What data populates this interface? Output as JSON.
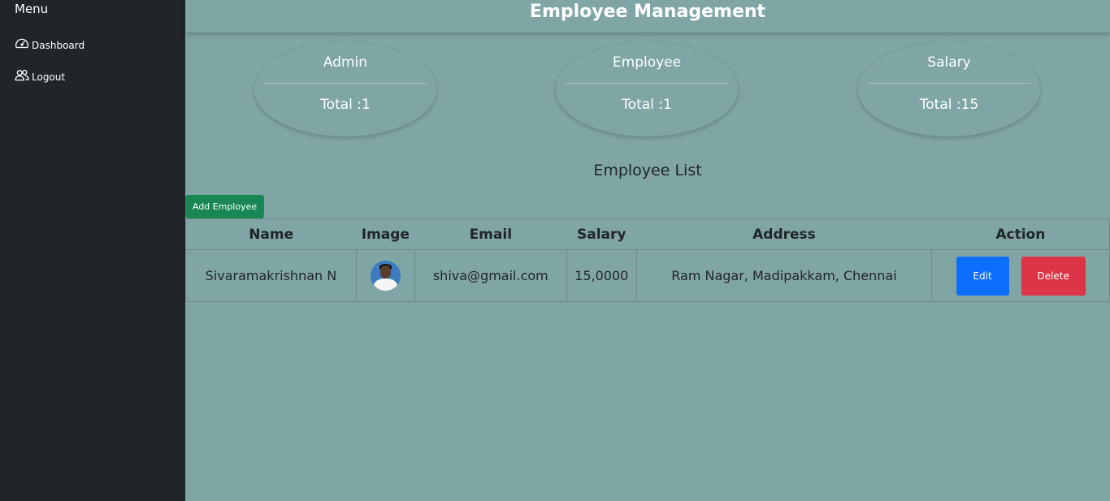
{
  "sidebar": {
    "title": "Menu",
    "items": [
      {
        "label": "Dashboard",
        "icon": "speedometer-icon"
      },
      {
        "label": "Logout",
        "icon": "people-icon"
      }
    ]
  },
  "header": {
    "title": "Employee Management"
  },
  "stats": [
    {
      "label": "Admin",
      "value": "Total :1"
    },
    {
      "label": "Employee",
      "value": "Total :1"
    },
    {
      "label": "Salary",
      "value": "Total :15"
    }
  ],
  "list": {
    "title": "Employee List",
    "add_button": "Add Employee",
    "columns": [
      "Name",
      "Image",
      "Email",
      "Salary",
      "Address",
      "Action"
    ],
    "rows": [
      {
        "name": "Sivaramakrishnan N",
        "email": "shiva@gmail.com",
        "salary": "15,0000",
        "address": "Ram Nagar, Madipakkam, Chennai",
        "edit": "Edit",
        "delete": "Delete"
      }
    ]
  },
  "colors": {
    "sidebar_bg": "#212529",
    "main_bg": "#7fa6a5",
    "add_button": "#198754",
    "edit_button": "#0d6efd",
    "delete_button": "#dc3545"
  }
}
